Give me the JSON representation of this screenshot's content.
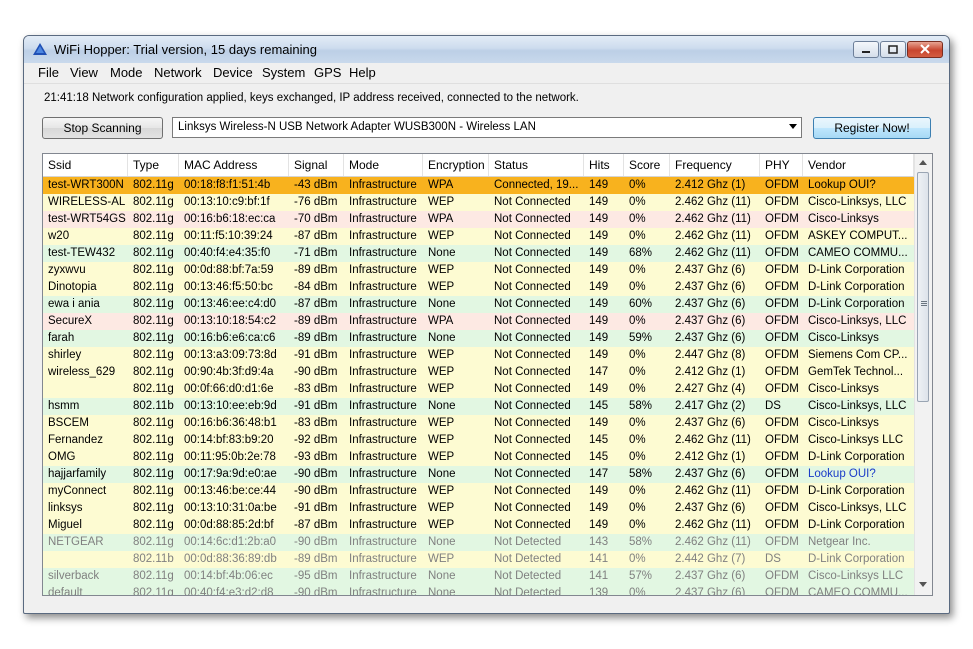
{
  "window": {
    "title": "WiFi Hopper: Trial version, 15 days remaining"
  },
  "menu": [
    "File",
    "View",
    "Mode",
    "Network",
    "Device",
    "System",
    "GPS",
    "Help"
  ],
  "status_message": "21:41:18 Network configuration applied, keys exchanged, IP address received, connected to the network.",
  "toolbar": {
    "stop_label": "Stop Scanning",
    "adapter": "Linksys Wireless-N USB Network Adapter WUSB300N - Wireless LAN",
    "register_label": "Register Now!"
  },
  "colors": {
    "selected": "#f8b21e",
    "wpa": "#fde9e3",
    "wep": "#fdfbd2",
    "none": "#e2f7e2",
    "undetected_text": "#808080",
    "link": "#1a3cc8"
  },
  "table": {
    "columns": [
      "Ssid",
      "Type",
      "MAC Address",
      "Signal",
      "Mode",
      "Encryption",
      "Status",
      "Hits",
      "Score",
      "Frequency",
      "PHY",
      "Vendor"
    ],
    "rows": [
      [
        "test-WRT300N",
        "802.11g",
        "00:18:f8:f1:51:4b",
        "-43 dBm",
        "Infrastructure",
        "WPA",
        "Connected, 19...",
        "149",
        "0%",
        "2.412 Ghz (1)",
        "OFDM",
        "Lookup OUI?"
      ],
      [
        "WIRELESS-AL",
        "802.11g",
        "00:13:10:c9:bf:1f",
        "-76 dBm",
        "Infrastructure",
        "WEP",
        "Not Connected",
        "149",
        "0%",
        "2.462 Ghz (11)",
        "OFDM",
        "Cisco-Linksys, LLC"
      ],
      [
        "test-WRT54GS",
        "802.11g",
        "00:16:b6:18:ec:ca",
        "-70 dBm",
        "Infrastructure",
        "WPA",
        "Not Connected",
        "149",
        "0%",
        "2.462 Ghz (11)",
        "OFDM",
        "Cisco-Linksys"
      ],
      [
        "w20",
        "802.11g",
        "00:11:f5:10:39:24",
        "-87 dBm",
        "Infrastructure",
        "WEP",
        "Not Connected",
        "149",
        "0%",
        "2.462 Ghz (11)",
        "OFDM",
        "ASKEY COMPUT..."
      ],
      [
        "test-TEW432",
        "802.11g",
        "00:40:f4:e4:35:f0",
        "-71 dBm",
        "Infrastructure",
        "None",
        "Not Connected",
        "149",
        "68%",
        "2.462 Ghz (11)",
        "OFDM",
        "CAMEO COMMU..."
      ],
      [
        "zyxwvu",
        "802.11g",
        "00:0d:88:bf:7a:59",
        "-89 dBm",
        "Infrastructure",
        "WEP",
        "Not Connected",
        "149",
        "0%",
        "2.437 Ghz (6)",
        "OFDM",
        "D-Link Corporation"
      ],
      [
        "Dinotopia",
        "802.11g",
        "00:13:46:f5:50:bc",
        "-84 dBm",
        "Infrastructure",
        "WEP",
        "Not Connected",
        "149",
        "0%",
        "2.437 Ghz (6)",
        "OFDM",
        "D-Link Corporation"
      ],
      [
        "ewa i ania",
        "802.11g",
        "00:13:46:ee:c4:d0",
        "-87 dBm",
        "Infrastructure",
        "None",
        "Not Connected",
        "149",
        "60%",
        "2.437 Ghz (6)",
        "OFDM",
        "D-Link Corporation"
      ],
      [
        "SecureX",
        "802.11g",
        "00:13:10:18:54:c2",
        "-89 dBm",
        "Infrastructure",
        "WPA",
        "Not Connected",
        "149",
        "0%",
        "2.437 Ghz (6)",
        "OFDM",
        "Cisco-Linksys, LLC"
      ],
      [
        "farah",
        "802.11g",
        "00:16:b6:e6:ca:c6",
        "-89 dBm",
        "Infrastructure",
        "None",
        "Not Connected",
        "149",
        "59%",
        "2.437 Ghz (6)",
        "OFDM",
        "Cisco-Linksys"
      ],
      [
        "shirley",
        "802.11g",
        "00:13:a3:09:73:8d",
        "-91 dBm",
        "Infrastructure",
        "WEP",
        "Not Connected",
        "149",
        "0%",
        "2.447 Ghz (8)",
        "OFDM",
        "Siemens Com CP..."
      ],
      [
        "wireless_629",
        "802.11g",
        "00:90:4b:3f:d9:4a",
        "-90 dBm",
        "Infrastructure",
        "WEP",
        "Not Connected",
        "147",
        "0%",
        "2.412 Ghz (1)",
        "OFDM",
        "GemTek Technol..."
      ],
      [
        "",
        "802.11g",
        "00:0f:66:d0:d1:6e",
        "-83 dBm",
        "Infrastructure",
        "WEP",
        "Not Connected",
        "149",
        "0%",
        "2.427 Ghz (4)",
        "OFDM",
        "Cisco-Linksys"
      ],
      [
        "hsmm",
        "802.11b",
        "00:13:10:ee:eb:9d",
        "-91 dBm",
        "Infrastructure",
        "None",
        "Not Connected",
        "145",
        "58%",
        "2.417 Ghz (2)",
        "DS",
        "Cisco-Linksys, LLC"
      ],
      [
        "BSCEM",
        "802.11g",
        "00:16:b6:36:48:b1",
        "-83 dBm",
        "Infrastructure",
        "WEP",
        "Not Connected",
        "149",
        "0%",
        "2.437 Ghz (6)",
        "OFDM",
        "Cisco-Linksys"
      ],
      [
        "Fernandez",
        "802.11g",
        "00:14:bf:83:b9:20",
        "-92 dBm",
        "Infrastructure",
        "WEP",
        "Not Connected",
        "145",
        "0%",
        "2.462 Ghz (11)",
        "OFDM",
        "Cisco-Linksys LLC"
      ],
      [
        "OMG",
        "802.11g",
        "00:11:95:0b:2e:78",
        "-93 dBm",
        "Infrastructure",
        "WEP",
        "Not Connected",
        "145",
        "0%",
        "2.412 Ghz (1)",
        "OFDM",
        "D-Link Corporation"
      ],
      [
        "hajjarfamily",
        "802.11g",
        "00:17:9a:9d:e0:ae",
        "-90 dBm",
        "Infrastructure",
        "None",
        "Not Connected",
        "147",
        "58%",
        "2.437 Ghz (6)",
        "OFDM",
        "Lookup OUI?"
      ],
      [
        "myConnect",
        "802.11g",
        "00:13:46:be:ce:44",
        "-90 dBm",
        "Infrastructure",
        "WEP",
        "Not Connected",
        "149",
        "0%",
        "2.462 Ghz (11)",
        "OFDM",
        "D-Link Corporation"
      ],
      [
        "linksys",
        "802.11g",
        "00:13:10:31:0a:be",
        "-91 dBm",
        "Infrastructure",
        "WEP",
        "Not Connected",
        "149",
        "0%",
        "2.437 Ghz (6)",
        "OFDM",
        "Cisco-Linksys, LLC"
      ],
      [
        "Miguel",
        "802.11g",
        "00:0d:88:85:2d:bf",
        "-87 dBm",
        "Infrastructure",
        "WEP",
        "Not Connected",
        "149",
        "0%",
        "2.462 Ghz (11)",
        "OFDM",
        "D-Link Corporation"
      ],
      [
        "NETGEAR",
        "802.11g",
        "00:14:6c:d1:2b:a0",
        "-90 dBm",
        "Infrastructure",
        "None",
        "Not Detected",
        "143",
        "58%",
        "2.462 Ghz (11)",
        "OFDM",
        "Netgear Inc."
      ],
      [
        "",
        "802.11b",
        "00:0d:88:36:89:db",
        "-89 dBm",
        "Infrastructure",
        "WEP",
        "Not Detected",
        "141",
        "0%",
        "2.442 Ghz (7)",
        "DS",
        "D-Link Corporation"
      ],
      [
        "silverback",
        "802.11g",
        "00:14:bf:4b:06:ec",
        "-95 dBm",
        "Infrastructure",
        "None",
        "Not Detected",
        "141",
        "57%",
        "2.437 Ghz (6)",
        "OFDM",
        "Cisco-Linksys LLC"
      ],
      [
        "default",
        "802.11g",
        "00:40:f4:e3:d2:d8",
        "-90 dBm",
        "Infrastructure",
        "None",
        "Not Detected",
        "139",
        "0%",
        "2.437 Ghz (6)",
        "OFDM",
        "CAMEO COMMU..."
      ]
    ]
  }
}
